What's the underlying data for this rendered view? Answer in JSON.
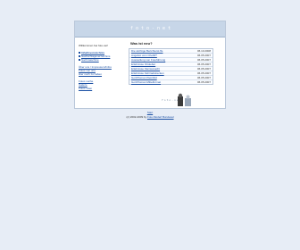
{
  "banner": {
    "logo": "foto-net"
  },
  "sidebar": {
    "welcome": "Willkommen bei foto-net!",
    "main_link": "Inhaltsverzeichnis",
    "links_group1": [
      "Nachschlageverzeichnis",
      "Suchmaschine"
    ],
    "links_group2": [
      "Über uns / Impressum/Infos",
      "Fotos von uns",
      "Hier noch zu haben"
    ],
    "links_group3": [
      "Fotos suche",
      "Galerie",
      "Fotos raten"
    ]
  },
  "news": {
    "title": "Was ist neu?",
    "items": [
      {
        "label": "Die wichtige Berichterst.ffe",
        "date": "06.10.2008"
      },
      {
        "label": "Angebot vom Chefkf?",
        "date": "06.05.2007"
      },
      {
        "label": "Ausstellung von Fotoführung",
        "date": "06.05.2007"
      },
      {
        "label": "Erlebnisse Ottoleber",
        "date": "06.05.2007"
      },
      {
        "label": "Erlebnisse Kleinsonacht",
        "date": "06.05.2007"
      },
      {
        "label": "Erlebnisse Fahrradstrecken",
        "date": "06.05.2007"
      },
      {
        "label": "Gorzhfoman Kleinbild",
        "date": "06.05.2007"
      },
      {
        "label": "Gorzhfoman Mittelformat",
        "date": "06.05.2007"
      }
    ]
  },
  "mascot": {
    "text": "foto-net"
  },
  "footer": {
    "top_link": "Start",
    "copyright": "(c) 2002-2009 by",
    "author_link": "Foto-Moderl Bundesal"
  },
  "colors": {
    "background": "#e7edf6",
    "banner": "#c7d6e8",
    "link": "#1a4fa3"
  }
}
